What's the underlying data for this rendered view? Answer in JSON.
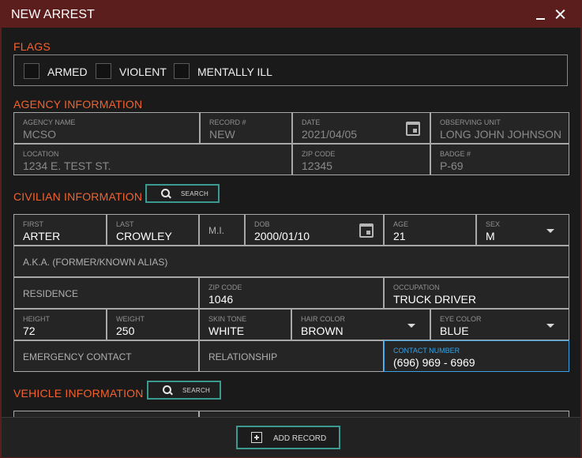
{
  "window": {
    "title": "NEW ARREST"
  },
  "flags": {
    "title": "FLAGS",
    "items": [
      {
        "label": "ARMED",
        "checked": false
      },
      {
        "label": "VIOLENT",
        "checked": false
      },
      {
        "label": "MENTALLY ILL",
        "checked": false
      }
    ]
  },
  "agency": {
    "title": "AGENCY INFORMATION",
    "agency_name": {
      "label": "AGENCY NAME",
      "value": "MCSO"
    },
    "record": {
      "label": "RECORD #",
      "value": "NEW"
    },
    "date": {
      "label": "DATE",
      "value": "2021/04/05"
    },
    "observing_unit": {
      "label": "OBSERVING UNIT",
      "value": "LONG JOHN JOHNSON"
    },
    "location": {
      "label": "LOCATION",
      "value": "1234 E. TEST ST."
    },
    "zip": {
      "label": "ZIP CODE",
      "value": "12345"
    },
    "badge": {
      "label": "BADGE #",
      "value": "P-69"
    }
  },
  "civilian": {
    "title": "CIVILIAN INFORMATION",
    "search_label": "SEARCH",
    "first": {
      "label": "FIRST",
      "value": "ARTER"
    },
    "last": {
      "label": "LAST",
      "value": "CROWLEY"
    },
    "mi": {
      "placeholder": "M.I."
    },
    "dob": {
      "label": "DOB",
      "value": "2000/01/10"
    },
    "age": {
      "label": "AGE",
      "value": "21"
    },
    "sex": {
      "label": "SEX",
      "value": "M"
    },
    "aka": {
      "placeholder": "A.K.A. (FORMER/KNOWN ALIAS)"
    },
    "residence": {
      "placeholder": "RESIDENCE"
    },
    "zip": {
      "label": "ZIP CODE",
      "value": "1046"
    },
    "occupation": {
      "label": "OCCUPATION",
      "value": "TRUCK DRIVER"
    },
    "height": {
      "label": "HEIGHT",
      "value": "72"
    },
    "weight": {
      "label": "WEIGHT",
      "value": "250"
    },
    "skin_tone": {
      "label": "SKIN TONE",
      "value": "WHITE"
    },
    "hair_color": {
      "label": "HAIR COLOR",
      "value": "BROWN"
    },
    "eye_color": {
      "label": "EYE COLOR",
      "value": "BLUE"
    },
    "emergency_contact": {
      "placeholder": "EMERGENCY CONTACT"
    },
    "relationship": {
      "placeholder": "RELATIONSHIP"
    },
    "contact_number": {
      "label": "CONTACT NUMBER",
      "value": "(696) 969 - 6969"
    }
  },
  "vehicle": {
    "title": "VEHICLE INFORMATION",
    "search_label": "SEARCH"
  },
  "footer": {
    "add_record_label": "ADD RECORD"
  },
  "colors": {
    "title_bar": "#5c1d1d",
    "section_title": "#f2622e",
    "accent_border": "#3a9a8f",
    "focus": "#3ba0e0"
  }
}
